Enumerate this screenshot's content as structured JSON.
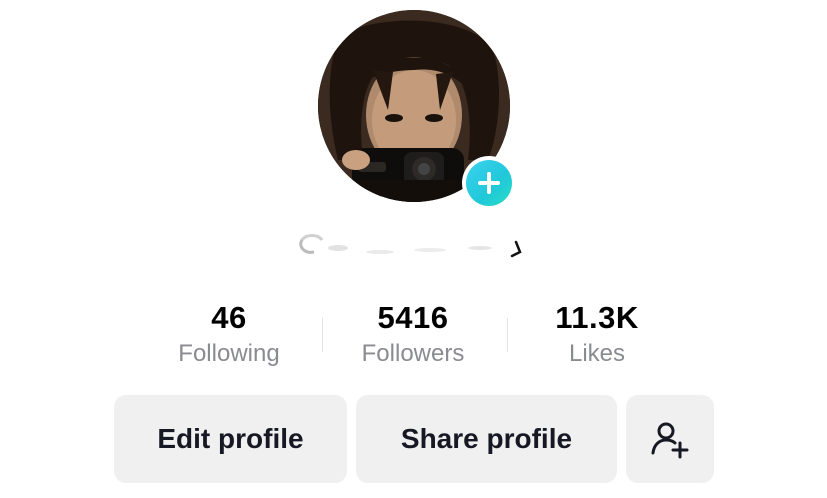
{
  "profile": {
    "avatar_icon": "profile-photo",
    "add_badge_icon": "plus-icon",
    "badge_color": "#2cc9e0"
  },
  "stats": {
    "following": {
      "value": "46",
      "label": "Following"
    },
    "followers": {
      "value": "5416",
      "label": "Followers"
    },
    "likes": {
      "value": "11.3K",
      "label": "Likes"
    }
  },
  "actions": {
    "edit_label": "Edit profile",
    "share_label": "Share profile",
    "add_friend_icon": "person-add-icon"
  }
}
